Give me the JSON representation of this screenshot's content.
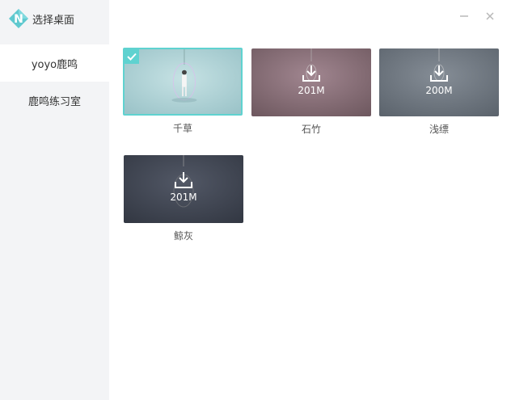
{
  "sidebar": {
    "title": "选择桌面",
    "items": [
      {
        "label": "yoyo鹿鸣",
        "active": true
      },
      {
        "label": "鹿鸣练习室",
        "active": false
      }
    ]
  },
  "window": {
    "minimize_icon": "minimize-icon",
    "close_icon": "close-icon"
  },
  "wallpapers": [
    {
      "name": "千草",
      "size": "",
      "selected": true,
      "downloaded": true,
      "color": "#a8cdd1"
    },
    {
      "name": "石竹",
      "size": "201M",
      "selected": false,
      "downloaded": false,
      "color": "#8a6d73"
    },
    {
      "name": "浅缥",
      "size": "200M",
      "selected": false,
      "downloaded": false,
      "color": "#6b737c"
    },
    {
      "name": "鲸灰",
      "size": "201M",
      "selected": false,
      "downloaded": false,
      "color": "#3f4450"
    }
  ],
  "colors": {
    "accent": "#5fd2d0",
    "sidebar_bg": "#f3f4f6"
  }
}
